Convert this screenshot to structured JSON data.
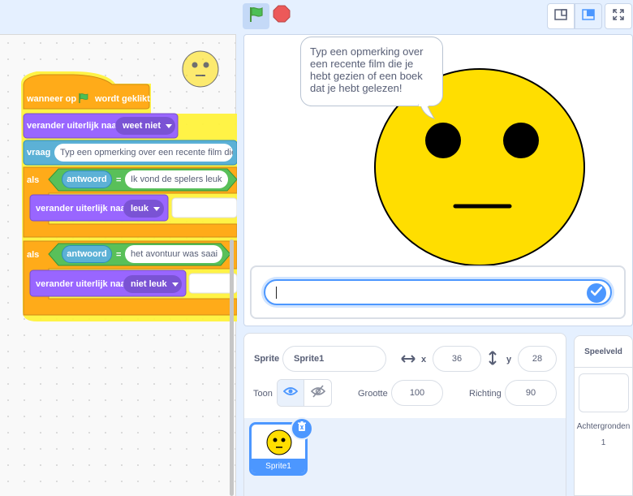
{
  "toolbar": {
    "green_flag_icon": "green-flag-icon",
    "stop_icon": "stop-icon",
    "layout_small_icon": "small-stage-icon",
    "layout_normal_icon": "normal-stage-icon",
    "fullscreen_icon": "fullscreen-icon"
  },
  "code": {
    "hat_label_1": "wanneer op",
    "hat_label_2": "wordt geklikt",
    "switch_costume_1": "verander uiterlijk naar",
    "costume_1": "weet niet",
    "ask_label": "vraag",
    "ask_text": "Typ een opmerking over een recente film die je h",
    "if_1_label": "als",
    "answer_1": "antwoord",
    "equals_1": "=",
    "compare_1": "Ik vond de spelers leuk",
    "switch_costume_2": "verander uiterlijk naar",
    "costume_2": "leuk",
    "if_2_label": "als",
    "answer_2": "antwoord",
    "equals_2": "=",
    "compare_2": "het avontuur was saai",
    "switch_costume_3": "verander uiterlijk naar",
    "costume_3": "niet leuk"
  },
  "stage": {
    "speech_bubble": "Typ een opmerking over een recente film die je hebt gezien of een boek dat je hebt gelezen!",
    "ask_input_value": "",
    "ask_submit_icon": "check-icon"
  },
  "sprite_info": {
    "sprite_label": "Sprite",
    "sprite_name": "Sprite1",
    "x_label": "x",
    "x_value": "36",
    "y_label": "y",
    "y_value": "28",
    "show_label": "Toon",
    "size_label": "Grootte",
    "size_value": "100",
    "direction_label": "Richting",
    "direction_value": "90"
  },
  "sprites": [
    {
      "name": "Sprite1",
      "selected": true
    }
  ],
  "backdrop": {
    "title": "Speelveld",
    "backdrops_label": "Achtergronden",
    "count": "1"
  },
  "colors": {
    "events": "#ffab19",
    "looks": "#9966ff",
    "sensing": "#5cb1d6",
    "operators": "#59c059",
    "accent": "#4c97ff",
    "face": "#ffde00"
  }
}
